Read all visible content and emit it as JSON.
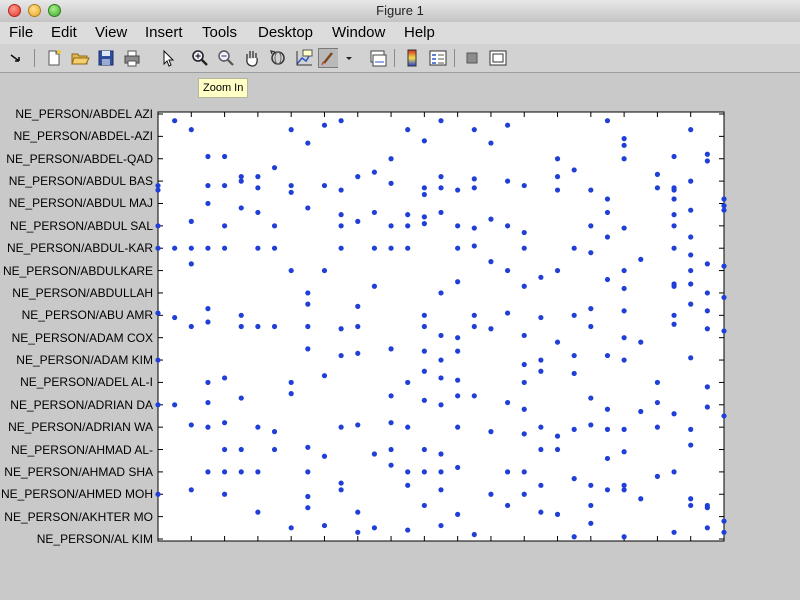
{
  "window": {
    "title": "Figure 1"
  },
  "menu": [
    "File",
    "Edit",
    "View",
    "Insert",
    "Tools",
    "Desktop",
    "Window",
    "Help"
  ],
  "toolbar": {
    "tools": [
      {
        "name": "edit-plot-arrow-icon"
      },
      {
        "name": "new-figure-icon"
      },
      {
        "name": "open-file-icon"
      },
      {
        "name": "save-figure-icon"
      },
      {
        "name": "print-figure-icon"
      },
      {
        "name": "edit-plot-pointer-icon"
      },
      {
        "name": "zoom-in-icon"
      },
      {
        "name": "zoom-out-icon"
      },
      {
        "name": "pan-hand-icon"
      },
      {
        "name": "rotate-3d-icon"
      },
      {
        "name": "data-cursor-icon"
      },
      {
        "name": "brush-icon"
      },
      {
        "name": "brush-dropdown-icon"
      },
      {
        "name": "link-plot-icon"
      },
      {
        "name": "insert-colorbar-icon"
      },
      {
        "name": "insert-legend-icon"
      },
      {
        "name": "hide-plot-tools-icon"
      },
      {
        "name": "show-plot-tools-icon"
      }
    ],
    "tooltip": "Zoom In"
  },
  "chart_data": {
    "type": "scatter",
    "marker_color": "#1f3fd6",
    "xlim": [
      0,
      34
    ],
    "ylim": [
      0,
      19
    ],
    "grid": false,
    "y_tick_labels": [
      "NE_PERSON/ABDEL AZI",
      "NE_PERSON/ABDEL-AZI",
      "NE_PERSON/ABDEL-QAD",
      "NE_PERSON/ABDUL BAS",
      "NE_PERSON/ABDUL MAJ",
      "NE_PERSON/ABDUL SAL",
      "NE_PERSON/ABDUL-KAR",
      "NE_PERSON/ABDULKARE",
      "NE_PERSON/ABDULLAH",
      "NE_PERSON/ABU AMR",
      "NE_PERSON/ADAM COX",
      "NE_PERSON/ADAM KIM",
      "NE_PERSON/ADEL AL-I",
      "NE_PERSON/ADRIAN DA",
      "NE_PERSON/ADRIAN WA",
      "NE_PERSON/AHMAD AL-",
      "NE_PERSON/AHMAD SHA",
      "NE_PERSON/AHMED MOH",
      "NE_PERSON/AKHTER MO",
      "NE_PERSON/AL KIM"
    ],
    "points": [
      [
        1,
        0.3
      ],
      [
        2,
        0.7
      ],
      [
        8,
        0.7
      ],
      [
        10,
        0.5
      ],
      [
        11,
        0.3
      ],
      [
        15,
        0.7
      ],
      [
        17,
        0.3
      ],
      [
        19,
        0.7
      ],
      [
        21,
        0.5
      ],
      [
        27,
        0.3
      ],
      [
        32,
        0.7
      ],
      [
        3,
        1.9
      ],
      [
        9,
        1.3
      ],
      [
        14,
        2.0
      ],
      [
        16,
        1.2
      ],
      [
        20,
        1.3
      ],
      [
        24,
        2.0
      ],
      [
        28,
        1.1
      ],
      [
        28,
        1.4
      ],
      [
        28,
        2.0
      ],
      [
        31,
        1.9
      ],
      [
        33,
        1.8
      ],
      [
        33,
        2.1
      ],
      [
        4,
        1.9
      ],
      [
        5,
        2.8
      ],
      [
        6,
        2.8
      ],
      [
        7,
        2.4
      ],
      [
        12,
        2.8
      ],
      [
        13,
        2.6
      ],
      [
        17,
        2.8
      ],
      [
        19,
        2.9
      ],
      [
        21,
        3.0
      ],
      [
        24,
        2.8
      ],
      [
        25,
        2.5
      ],
      [
        26,
        3.4
      ],
      [
        27,
        3.8
      ],
      [
        30,
        2.7
      ],
      [
        31,
        3.4
      ],
      [
        31,
        3.8
      ],
      [
        0,
        3.2
      ],
      [
        0,
        3.4
      ],
      [
        3,
        3.2
      ],
      [
        4,
        3.2
      ],
      [
        5,
        3.0
      ],
      [
        6,
        3.3
      ],
      [
        8,
        3.2
      ],
      [
        8,
        3.5
      ],
      [
        10,
        3.2
      ],
      [
        11,
        3.4
      ],
      [
        14,
        3.1
      ],
      [
        16,
        3.3
      ],
      [
        16,
        3.6
      ],
      [
        17,
        3.3
      ],
      [
        18,
        3.4
      ],
      [
        19,
        3.3
      ],
      [
        22,
        3.2
      ],
      [
        24,
        3.4
      ],
      [
        30,
        3.3
      ],
      [
        31,
        3.3
      ],
      [
        32,
        3.0
      ],
      [
        34,
        3.8
      ],
      [
        34,
        4.1
      ],
      [
        3,
        4.0
      ],
      [
        5,
        4.2
      ],
      [
        6,
        4.4
      ],
      [
        9,
        4.2
      ],
      [
        11,
        4.5
      ],
      [
        13,
        4.4
      ],
      [
        15,
        4.5
      ],
      [
        16,
        4.6
      ],
      [
        17,
        4.4
      ],
      [
        20,
        4.7
      ],
      [
        27,
        4.4
      ],
      [
        31,
        4.5
      ],
      [
        32,
        4.3
      ],
      [
        34,
        4.3
      ],
      [
        0,
        5.0
      ],
      [
        2,
        4.8
      ],
      [
        4,
        5.0
      ],
      [
        7,
        5.0
      ],
      [
        11,
        5.0
      ],
      [
        12,
        4.8
      ],
      [
        14,
        5.0
      ],
      [
        15,
        5.0
      ],
      [
        16,
        4.9
      ],
      [
        18,
        5.0
      ],
      [
        19,
        5.1
      ],
      [
        21,
        5.0
      ],
      [
        22,
        5.3
      ],
      [
        26,
        5.0
      ],
      [
        27,
        5.5
      ],
      [
        28,
        5.1
      ],
      [
        31,
        5.0
      ],
      [
        32,
        5.5
      ],
      [
        0,
        6.0
      ],
      [
        1,
        6.0
      ],
      [
        2,
        6.0
      ],
      [
        3,
        6.0
      ],
      [
        4,
        6.0
      ],
      [
        6,
        6.0
      ],
      [
        7,
        6.0
      ],
      [
        11,
        6.0
      ],
      [
        13,
        6.0
      ],
      [
        14,
        6.0
      ],
      [
        15,
        6.0
      ],
      [
        18,
        6.0
      ],
      [
        19,
        5.9
      ],
      [
        22,
        6.0
      ],
      [
        25,
        6.0
      ],
      [
        26,
        6.2
      ],
      [
        29,
        6.5
      ],
      [
        31,
        6.0
      ],
      [
        32,
        6.3
      ],
      [
        33,
        6.7
      ],
      [
        34,
        6.8
      ],
      [
        2,
        6.7
      ],
      [
        8,
        7.0
      ],
      [
        10,
        7.0
      ],
      [
        20,
        6.6
      ],
      [
        21,
        7.0
      ],
      [
        23,
        7.3
      ],
      [
        24,
        7.0
      ],
      [
        28,
        7.0
      ],
      [
        31,
        7.6
      ],
      [
        32,
        7.0
      ],
      [
        9,
        8.0
      ],
      [
        13,
        7.7
      ],
      [
        17,
        8.0
      ],
      [
        18,
        7.5
      ],
      [
        22,
        7.7
      ],
      [
        27,
        7.4
      ],
      [
        28,
        7.8
      ],
      [
        31,
        7.7
      ],
      [
        32,
        7.6
      ],
      [
        33,
        8.0
      ],
      [
        34,
        8.2
      ],
      [
        0,
        8.9
      ],
      [
        1,
        9.1
      ],
      [
        3,
        8.7
      ],
      [
        5,
        9.0
      ],
      [
        9,
        8.5
      ],
      [
        12,
        8.6
      ],
      [
        16,
        9.0
      ],
      [
        19,
        9.0
      ],
      [
        21,
        8.9
      ],
      [
        23,
        9.1
      ],
      [
        25,
        9.0
      ],
      [
        26,
        8.7
      ],
      [
        28,
        8.8
      ],
      [
        31,
        9.0
      ],
      [
        32,
        8.5
      ],
      [
        33,
        8.8
      ],
      [
        2,
        9.5
      ],
      [
        3,
        9.3
      ],
      [
        5,
        9.5
      ],
      [
        6,
        9.5
      ],
      [
        7,
        9.5
      ],
      [
        9,
        9.5
      ],
      [
        11,
        9.6
      ],
      [
        12,
        9.5
      ],
      [
        16,
        9.5
      ],
      [
        17,
        9.9
      ],
      [
        18,
        10.0
      ],
      [
        19,
        9.5
      ],
      [
        20,
        9.6
      ],
      [
        22,
        9.9
      ],
      [
        24,
        10.2
      ],
      [
        26,
        9.5
      ],
      [
        28,
        10.0
      ],
      [
        29,
        10.2
      ],
      [
        31,
        9.4
      ],
      [
        33,
        9.6
      ],
      [
        34,
        9.7
      ],
      [
        0,
        11.0
      ],
      [
        9,
        10.5
      ],
      [
        11,
        10.8
      ],
      [
        12,
        10.7
      ],
      [
        14,
        10.5
      ],
      [
        16,
        10.6
      ],
      [
        17,
        11.0
      ],
      [
        18,
        10.6
      ],
      [
        22,
        11.2
      ],
      [
        23,
        11.0
      ],
      [
        25,
        10.8
      ],
      [
        27,
        10.8
      ],
      [
        28,
        11.0
      ],
      [
        32,
        10.9
      ],
      [
        3,
        12.0
      ],
      [
        4,
        11.8
      ],
      [
        8,
        12.0
      ],
      [
        10,
        11.7
      ],
      [
        15,
        12.0
      ],
      [
        16,
        11.5
      ],
      [
        17,
        11.8
      ],
      [
        18,
        11.9
      ],
      [
        22,
        12.0
      ],
      [
        23,
        11.5
      ],
      [
        25,
        11.6
      ],
      [
        30,
        12.0
      ],
      [
        33,
        12.2
      ],
      [
        0,
        13.0
      ],
      [
        1,
        13.0
      ],
      [
        3,
        12.9
      ],
      [
        5,
        12.7
      ],
      [
        8,
        12.5
      ],
      [
        14,
        12.6
      ],
      [
        16,
        12.8
      ],
      [
        17,
        13.0
      ],
      [
        18,
        12.6
      ],
      [
        19,
        12.6
      ],
      [
        21,
        12.9
      ],
      [
        22,
        13.2
      ],
      [
        26,
        12.7
      ],
      [
        27,
        13.2
      ],
      [
        29,
        13.3
      ],
      [
        30,
        12.9
      ],
      [
        31,
        13.4
      ],
      [
        33,
        13.1
      ],
      [
        34,
        13.5
      ],
      [
        2,
        13.9
      ],
      [
        3,
        14.0
      ],
      [
        4,
        13.8
      ],
      [
        6,
        14.0
      ],
      [
        7,
        14.2
      ],
      [
        11,
        14.0
      ],
      [
        12,
        13.9
      ],
      [
        14,
        13.8
      ],
      [
        15,
        14.0
      ],
      [
        18,
        14.0
      ],
      [
        20,
        14.2
      ],
      [
        22,
        14.3
      ],
      [
        23,
        14.0
      ],
      [
        24,
        14.4
      ],
      [
        25,
        14.1
      ],
      [
        26,
        13.9
      ],
      [
        27,
        14.1
      ],
      [
        28,
        14.1
      ],
      [
        30,
        14.0
      ],
      [
        32,
        14.1
      ],
      [
        4,
        15.0
      ],
      [
        5,
        15.0
      ],
      [
        7,
        15.0
      ],
      [
        9,
        14.9
      ],
      [
        10,
        15.3
      ],
      [
        13,
        15.2
      ],
      [
        14,
        15.0
      ],
      [
        16,
        15.0
      ],
      [
        17,
        15.2
      ],
      [
        23,
        15.0
      ],
      [
        24,
        15.0
      ],
      [
        27,
        15.4
      ],
      [
        28,
        15.1
      ],
      [
        32,
        14.8
      ],
      [
        3,
        16.0
      ],
      [
        4,
        16.0
      ],
      [
        5,
        16.0
      ],
      [
        6,
        16.0
      ],
      [
        9,
        16.0
      ],
      [
        11,
        16.5
      ],
      [
        14,
        15.7
      ],
      [
        15,
        16.0
      ],
      [
        16,
        16.0
      ],
      [
        17,
        16.0
      ],
      [
        18,
        15.8
      ],
      [
        21,
        16.0
      ],
      [
        22,
        16.0
      ],
      [
        25,
        16.3
      ],
      [
        26,
        16.6
      ],
      [
        28,
        16.8
      ],
      [
        30,
        16.2
      ],
      [
        31,
        16.0
      ],
      [
        0,
        17.0
      ],
      [
        2,
        16.8
      ],
      [
        4,
        17.0
      ],
      [
        9,
        17.1
      ],
      [
        11,
        16.8
      ],
      [
        15,
        16.6
      ],
      [
        17,
        16.8
      ],
      [
        20,
        17.0
      ],
      [
        22,
        17.0
      ],
      [
        23,
        16.6
      ],
      [
        27,
        16.8
      ],
      [
        28,
        16.6
      ],
      [
        32,
        17.2
      ],
      [
        33,
        17.5
      ],
      [
        6,
        17.8
      ],
      [
        9,
        17.6
      ],
      [
        12,
        17.8
      ],
      [
        16,
        17.5
      ],
      [
        18,
        17.9
      ],
      [
        21,
        17.5
      ],
      [
        23,
        17.8
      ],
      [
        24,
        17.9
      ],
      [
        26,
        17.5
      ],
      [
        29,
        17.2
      ],
      [
        32,
        17.5
      ],
      [
        33,
        17.6
      ],
      [
        8,
        18.5
      ],
      [
        10,
        18.4
      ],
      [
        12,
        18.7
      ],
      [
        13,
        18.5
      ],
      [
        15,
        18.6
      ],
      [
        17,
        18.4
      ],
      [
        19,
        18.8
      ],
      [
        25,
        18.9
      ],
      [
        26,
        18.3
      ],
      [
        28,
        18.9
      ],
      [
        31,
        18.7
      ],
      [
        33,
        18.5
      ],
      [
        34,
        18.2
      ],
      [
        34,
        18.7
      ]
    ]
  }
}
